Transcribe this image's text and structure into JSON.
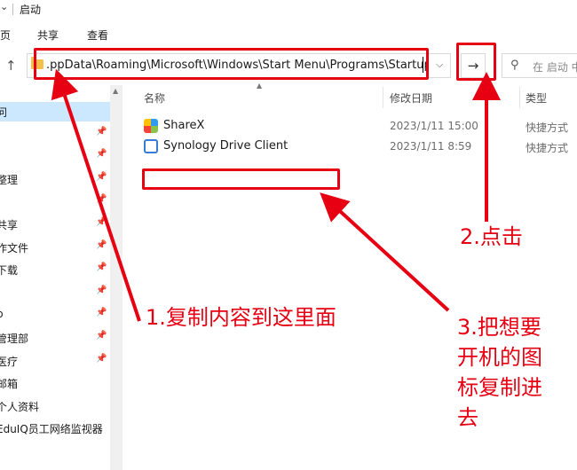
{
  "window": {
    "title": "启动",
    "chevron_icon": "chevron-down-icon"
  },
  "ribbon": {
    "tabs": [
      "页",
      "共享",
      "查看"
    ]
  },
  "address": {
    "path": ".ppData\\Roaming\\Microsoft\\Windows\\Start Menu\\Programs\\Startup",
    "up_icon": "up-arrow-icon",
    "go_label": "→",
    "search_placeholder": "在 启动 中"
  },
  "nav_pane": {
    "items": [
      {
        "label": "问",
        "selected": true,
        "pinned": false
      },
      {
        "label": "",
        "selected": false,
        "pinned": true
      },
      {
        "label": "",
        "selected": false,
        "pinned": true
      },
      {
        "label": "整理",
        "selected": false,
        "pinned": true
      },
      {
        "label": "",
        "selected": false,
        "pinned": true
      },
      {
        "label": "共享",
        "selected": false,
        "pinned": true
      },
      {
        "label": "作文件",
        "selected": false,
        "pinned": true
      },
      {
        "label": "下载",
        "selected": false,
        "pinned": true
      },
      {
        "label": "",
        "selected": false,
        "pinned": true
      },
      {
        "label": "p",
        "selected": false,
        "pinned": true
      },
      {
        "label": "管理部",
        "selected": false,
        "pinned": true
      },
      {
        "label": "医疗",
        "selected": false,
        "pinned": true
      },
      {
        "label": "邮箱",
        "selected": false,
        "pinned": false
      },
      {
        "label": "个人资料",
        "selected": false,
        "pinned": false
      },
      {
        "label": "EduIQ员工网络监视器",
        "selected": false,
        "pinned": false
      }
    ]
  },
  "columns": {
    "name": "名称",
    "modified": "修改日期",
    "type": "类型"
  },
  "files": [
    {
      "name": "ShareX",
      "modified": "2023/1/11 15:00",
      "type": "快捷方式",
      "icon": "sharex-icon",
      "color": "#2f9cf0"
    },
    {
      "name": "Synology Drive Client",
      "modified": "2023/1/11 8:59",
      "type": "快捷方式",
      "icon": "synology-drive-icon",
      "color": "#3a7bd5"
    }
  ],
  "annotations": {
    "step1": "1.复制内容到这里面",
    "step2": "2.点击",
    "step3_lines": [
      "3.把想要",
      "开机的图",
      "标复制进",
      "去"
    ]
  },
  "colors": {
    "highlight": "#e60012",
    "selected_bg": "#cce8ff"
  }
}
